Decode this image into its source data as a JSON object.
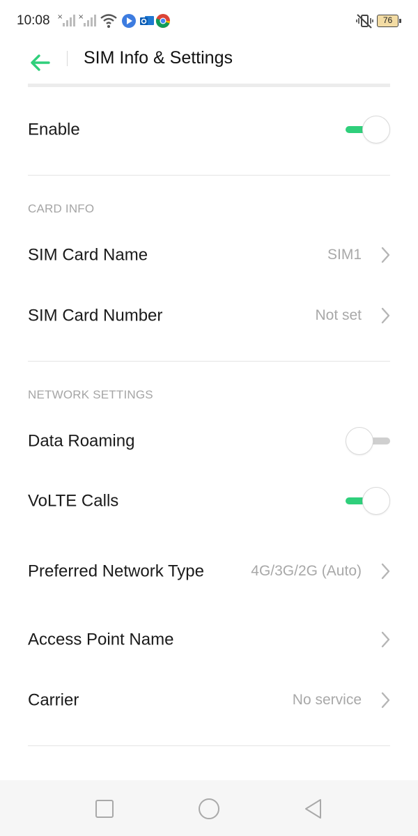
{
  "status_bar": {
    "time": "10:08",
    "left_icons": [
      "signal-off-icon",
      "signal-off-icon",
      "wifi-icon",
      "play-icon",
      "outlook-icon",
      "chrome-icon"
    ],
    "right_icons": [
      "vibrate-off-icon"
    ],
    "battery": "76"
  },
  "header": {
    "title": "SIM Info & Settings",
    "accent_color": "#2fcf7b"
  },
  "enable": {
    "label": "Enable",
    "toggle_on": true
  },
  "card_info": {
    "section_title": "CARD INFO",
    "sim_card_name": {
      "label": "SIM Card Name",
      "value": "SIM1"
    },
    "sim_card_number": {
      "label": "SIM Card Number",
      "value": "Not set"
    }
  },
  "network_settings": {
    "section_title": "NETWORK SETTINGS",
    "data_roaming": {
      "label": "Data Roaming",
      "toggle_on": false
    },
    "volte_calls": {
      "label": "VoLTE Calls",
      "toggle_on": true
    },
    "preferred_network_type": {
      "label": "Preferred Network Type",
      "value": "4G/3G/2G (Auto)"
    },
    "access_point_name": {
      "label": "Access Point Name"
    },
    "carrier": {
      "label": "Carrier",
      "value": "No service"
    }
  },
  "nav_bar": {
    "buttons": [
      "recents-square-icon",
      "home-circle-icon",
      "back-triangle-icon"
    ]
  }
}
